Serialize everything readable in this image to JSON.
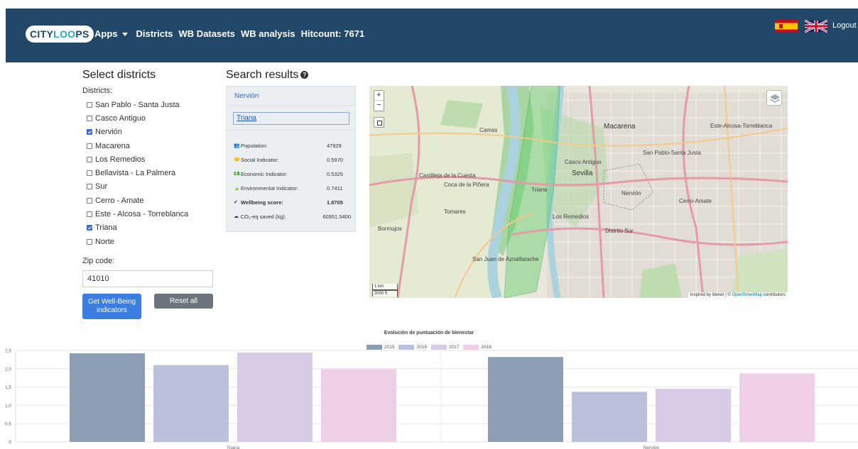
{
  "navbar": {
    "logo_parts": [
      "CITY",
      "LOO",
      "PS"
    ],
    "apps": "Apps",
    "districts": "Districts",
    "wb_datasets": "WB Datasets",
    "wb_analysis": "WB analysis",
    "hitcount": "Hitcount: 7671",
    "logout": "Logout"
  },
  "sidebar": {
    "title": "Select districts",
    "districts_label": "Districts:",
    "districts": [
      {
        "label": "San Pablo - Santa Justa",
        "checked": false
      },
      {
        "label": "Casco Antiguo",
        "checked": false
      },
      {
        "label": "Nervión",
        "checked": true
      },
      {
        "label": "Macarena",
        "checked": false
      },
      {
        "label": "Los Remedios",
        "checked": false
      },
      {
        "label": "Bellavista - La Palmera",
        "checked": false
      },
      {
        "label": "Sur",
        "checked": false
      },
      {
        "label": "Cerro - Amate",
        "checked": false
      },
      {
        "label": "Este - Alcosa - Torreblanca",
        "checked": false
      },
      {
        "label": "Triana",
        "checked": true
      },
      {
        "label": "Norte",
        "checked": false
      }
    ],
    "zip_label": "Zip code:",
    "zip_value": "41010",
    "get_button": "Get Well-Being indicators",
    "reset_button": "Reset all"
  },
  "results": {
    "title": "Search results",
    "help_icon": "question-circle-icon",
    "head": "Nervión",
    "active_tab": "Triana",
    "stats": [
      {
        "icon": "users-icon",
        "glyph": "👥",
        "label": "Population:",
        "value": "47929",
        "bold": false
      },
      {
        "icon": "handshake-icon",
        "glyph": "🤝",
        "label": "Social Indicator:",
        "value": "0.5970",
        "bold": false
      },
      {
        "icon": "money-icon",
        "glyph": "💵",
        "label": "Economic Indicator:",
        "value": "0.5325",
        "bold": false
      },
      {
        "icon": "leaf-icon",
        "glyph": "🍃",
        "label": "Environmental Indicator:",
        "value": "0.7411",
        "bold": false
      },
      {
        "icon": "check-circle-icon",
        "glyph": "✔",
        "label": "Wellbeing score:",
        "value": "1.8705",
        "bold": true
      },
      {
        "icon": "cloud-icon",
        "glyph": "☁",
        "label": "CO₂-eq saved (kg):",
        "value": "60951.5400",
        "bold": false
      }
    ]
  },
  "map": {
    "zoom_in": "+",
    "zoom_out": "−",
    "scale_km": "1 km",
    "scale_ft": "3000 ft",
    "attribution_prefix": "Inspired by Idener | © ",
    "attribution_link": "OpenStreetMap",
    "attribution_suffix": " contributors",
    "labels": [
      "Camas",
      "Castilleja de la Cuesta",
      "Casco Antiguo",
      "Sevilla",
      "Macarena",
      "San Pablo-Santa Justa",
      "Nervión",
      "Triana",
      "Los Remedios",
      "Distrito Sur",
      "Tomares",
      "Bormujos",
      "San Juan de Aznalfarache",
      "Cerro-Amate",
      "Este-Alcosa-Torreblanca",
      "Coca de la Piñera"
    ]
  },
  "chart_data": {
    "type": "bar",
    "title": "Evolución de puntuación de bienestar",
    "categories": [
      "Triana",
      "Nervión"
    ],
    "series": [
      {
        "name": "2015",
        "color": "#8b9eb3",
        "values": [
          2.42,
          2.32
        ]
      },
      {
        "name": "2016",
        "color": "#bcc1db",
        "values": [
          2.1,
          1.37
        ]
      },
      {
        "name": "2017",
        "color": "#d8cbe6",
        "values": [
          2.44,
          1.45
        ]
      },
      {
        "name": "2018",
        "color": "#efcfe8",
        "values": [
          1.99,
          1.87
        ]
      }
    ],
    "yticks": [
      "0",
      "0,5",
      "1,0",
      "1,5",
      "2,0",
      "2,5"
    ],
    "ylim": [
      0,
      2.5
    ],
    "legend": "top",
    "grid": true
  }
}
